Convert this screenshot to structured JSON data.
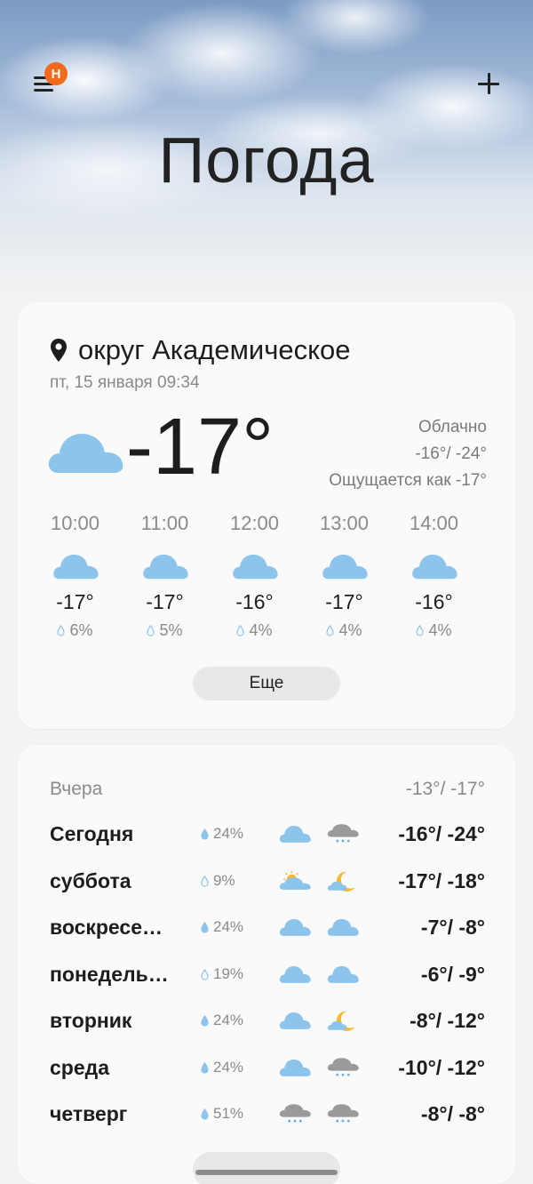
{
  "header": {
    "title": "Погода",
    "badge": "Н"
  },
  "current": {
    "location": "округ Академическое",
    "datetime": "пт, 15 января 09:34",
    "temperature": "-17°",
    "condition": "Облачно",
    "high_low": "-16°/ -24°",
    "feels_like": "Ощущается как -17°",
    "icon": "cloud-icon"
  },
  "hourly": [
    {
      "time": "10:00",
      "temp": "-17°",
      "precip": "6%",
      "icon": "cloud-icon"
    },
    {
      "time": "11:00",
      "temp": "-17°",
      "precip": "5%",
      "icon": "cloud-icon"
    },
    {
      "time": "12:00",
      "temp": "-16°",
      "precip": "4%",
      "icon": "cloud-icon"
    },
    {
      "time": "13:00",
      "temp": "-17°",
      "precip": "4%",
      "icon": "cloud-icon"
    },
    {
      "time": "14:00",
      "temp": "-16°",
      "precip": "4%",
      "icon": "cloud-icon"
    }
  ],
  "more_label": "Еще",
  "yesterday": {
    "label": "Вчера",
    "temps": "-13°/ -17°"
  },
  "daily": [
    {
      "day": "Сегодня",
      "precip": "24%",
      "day_icon": "cloud-icon",
      "night_icon": "snow-cloud-icon",
      "temps": "-16°/ -24°"
    },
    {
      "day": "суббота",
      "precip": "9%",
      "day_icon": "sun-cloud-icon",
      "night_icon": "moon-cloud-icon",
      "temps": "-17°/ -18°"
    },
    {
      "day": "воскресе…",
      "precip": "24%",
      "day_icon": "cloud-icon",
      "night_icon": "cloud-icon",
      "temps": "-7°/ -8°"
    },
    {
      "day": "понедель…",
      "precip": "19%",
      "day_icon": "cloud-icon",
      "night_icon": "cloud-icon",
      "temps": "-6°/ -9°"
    },
    {
      "day": "вторник",
      "precip": "24%",
      "day_icon": "cloud-icon",
      "night_icon": "moon-cloud-icon",
      "temps": "-8°/ -12°"
    },
    {
      "day": "среда",
      "precip": "24%",
      "day_icon": "cloud-icon",
      "night_icon": "snow-cloud-icon",
      "temps": "-10°/ -12°"
    },
    {
      "day": "четверг",
      "precip": "51%",
      "day_icon": "snow-cloud-icon",
      "night_icon": "snow-cloud-icon",
      "temps": "-8°/ -8°"
    }
  ],
  "colors": {
    "cloud": "#8cc4ec",
    "badge": "#f26a1b",
    "muted_text": "#8a8a8a",
    "card_bg": "#fafafa"
  }
}
